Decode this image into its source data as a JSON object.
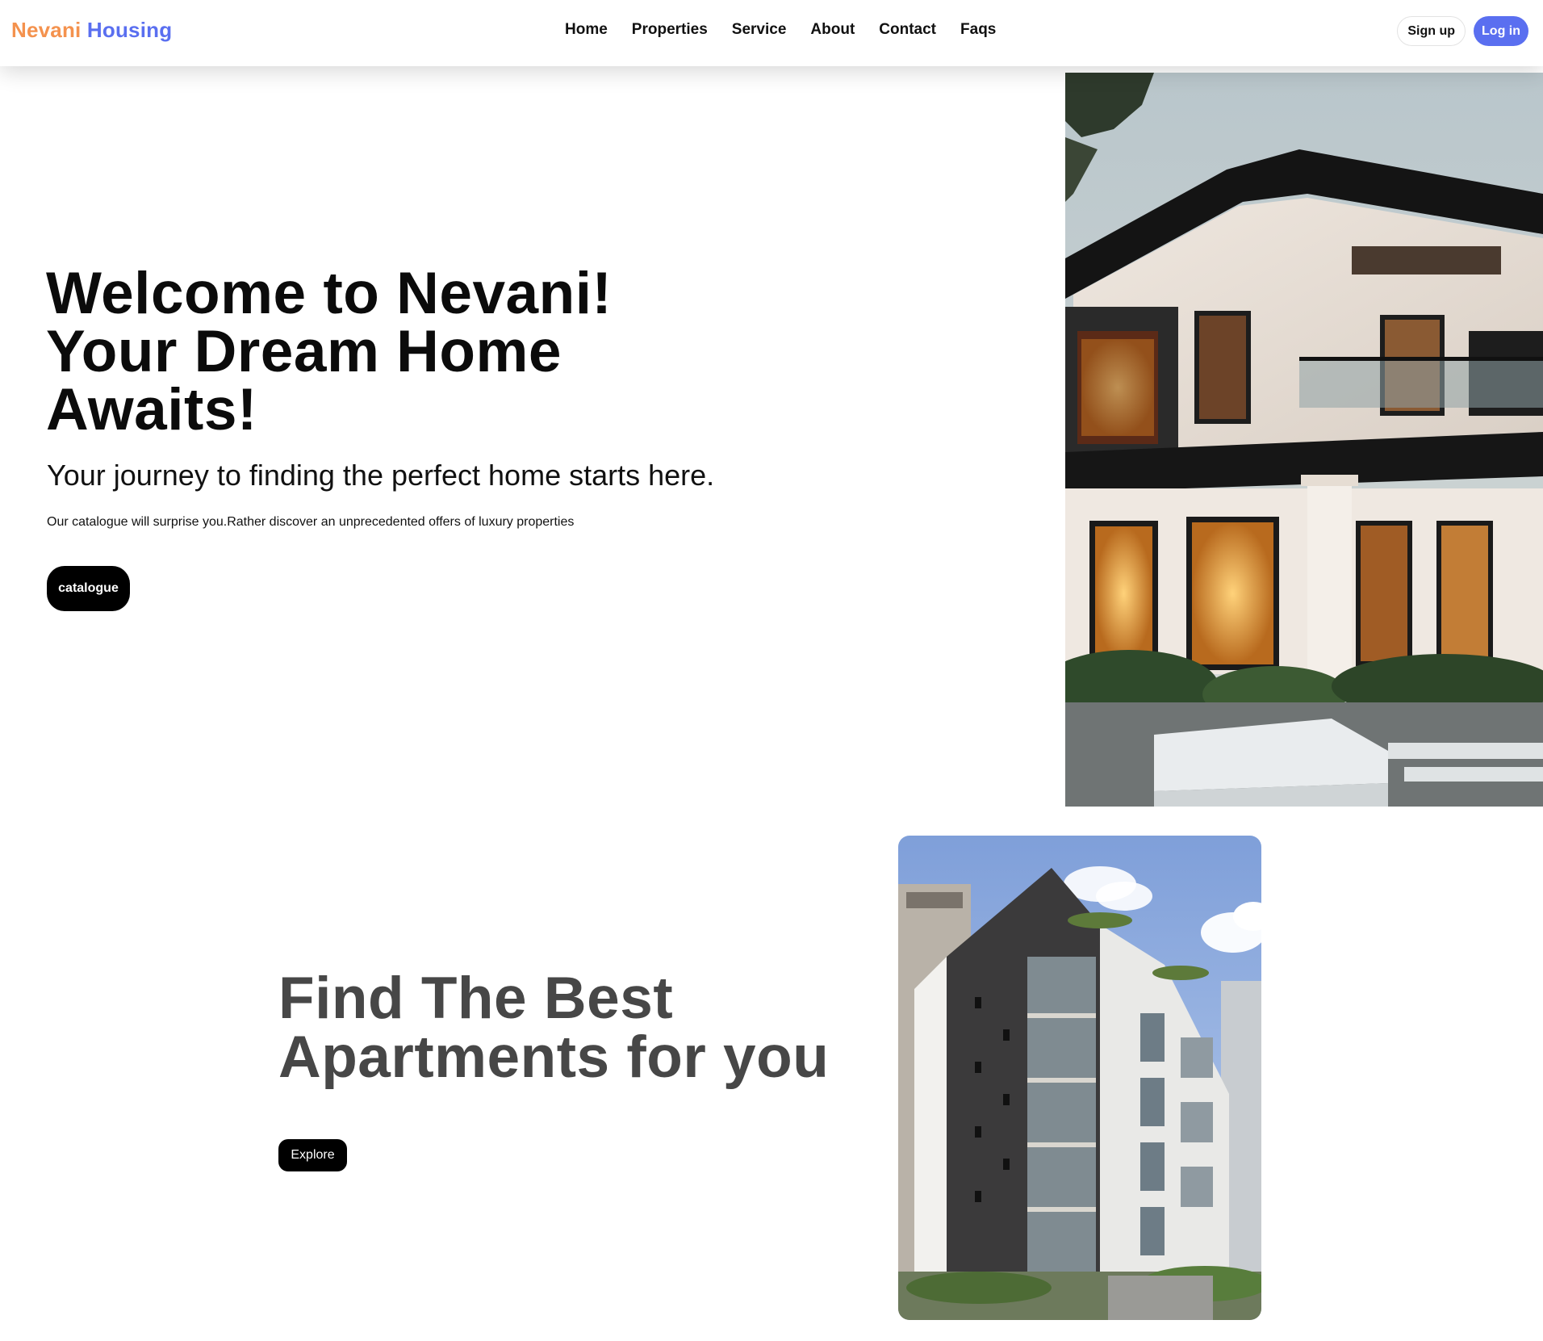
{
  "brand": {
    "part1": "Nevani",
    "part2": "Housing",
    "color1": "#f4924e",
    "color2": "#5a6ff0"
  },
  "nav": {
    "links": [
      "Home",
      "Properties",
      "Service",
      "About",
      "Contact",
      "Faqs"
    ]
  },
  "auth": {
    "signup_label": "Sign up",
    "login_label": "Log in",
    "login_color": "#5a6ff0"
  },
  "hero": {
    "title_line1": "Welcome to Nevani!",
    "title_line2": "Your Dream Home",
    "title_line3": "Awaits!",
    "subtitle": "Your journey to finding the perfect home starts here.",
    "description": "Our catalogue will surprise you.Rather discover an unprecedented offers of luxury properties",
    "cta_label": "catalogue"
  },
  "apartments": {
    "title_line1": "Find The Best",
    "title_line2": "Apartments for you",
    "cta_label": "Explore"
  }
}
